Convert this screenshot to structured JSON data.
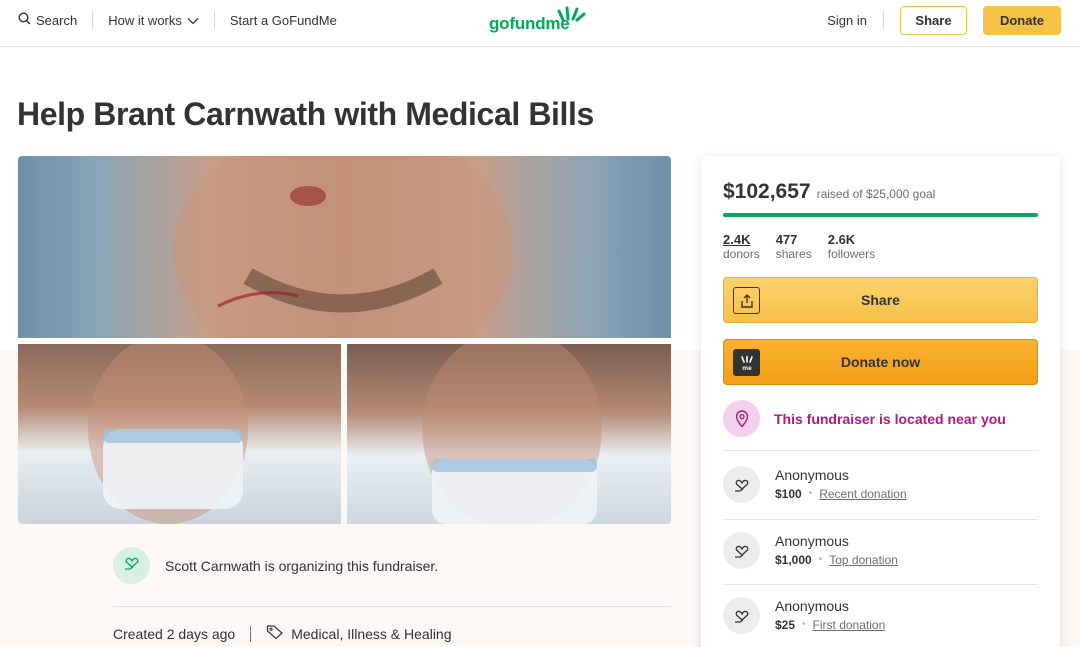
{
  "header": {
    "search_label": "Search",
    "how_it_works_label": "How it works",
    "start_label": "Start a GoFundMe",
    "logo_text": "gofundme",
    "sign_in_label": "Sign in",
    "share_label": "Share",
    "donate_label": "Donate"
  },
  "campaign": {
    "title": "Help Brant Carnwath with Medical Bills",
    "organizer_text": "Scott Carnwath is organizing this fundraiser.",
    "created": "Created 2 days ago",
    "category": "Medical, Illness & Healing"
  },
  "donation_card": {
    "raised": "$102,657",
    "goal_text": "raised of $25,000 goal",
    "progress_fraction": 1.0,
    "stats": [
      {
        "value": "2.4K",
        "label": "donors"
      },
      {
        "value": "477",
        "label": "shares"
      },
      {
        "value": "2.6K",
        "label": "followers"
      }
    ],
    "share_label": "Share",
    "donate_label": "Donate now",
    "nearby_text": "This fundraiser is located near you",
    "donations": [
      {
        "name": "Anonymous",
        "amount": "$100",
        "type": "Recent donation"
      },
      {
        "name": "Anonymous",
        "amount": "$1,000",
        "type": "Top donation"
      },
      {
        "name": "Anonymous",
        "amount": "$25",
        "type": "First donation"
      }
    ]
  },
  "colors": {
    "brand_green": "#02a95c",
    "cta_yellow": "#f4c245",
    "cta_orange": "#f39f18",
    "nearby_magenta": "#b0197e"
  }
}
